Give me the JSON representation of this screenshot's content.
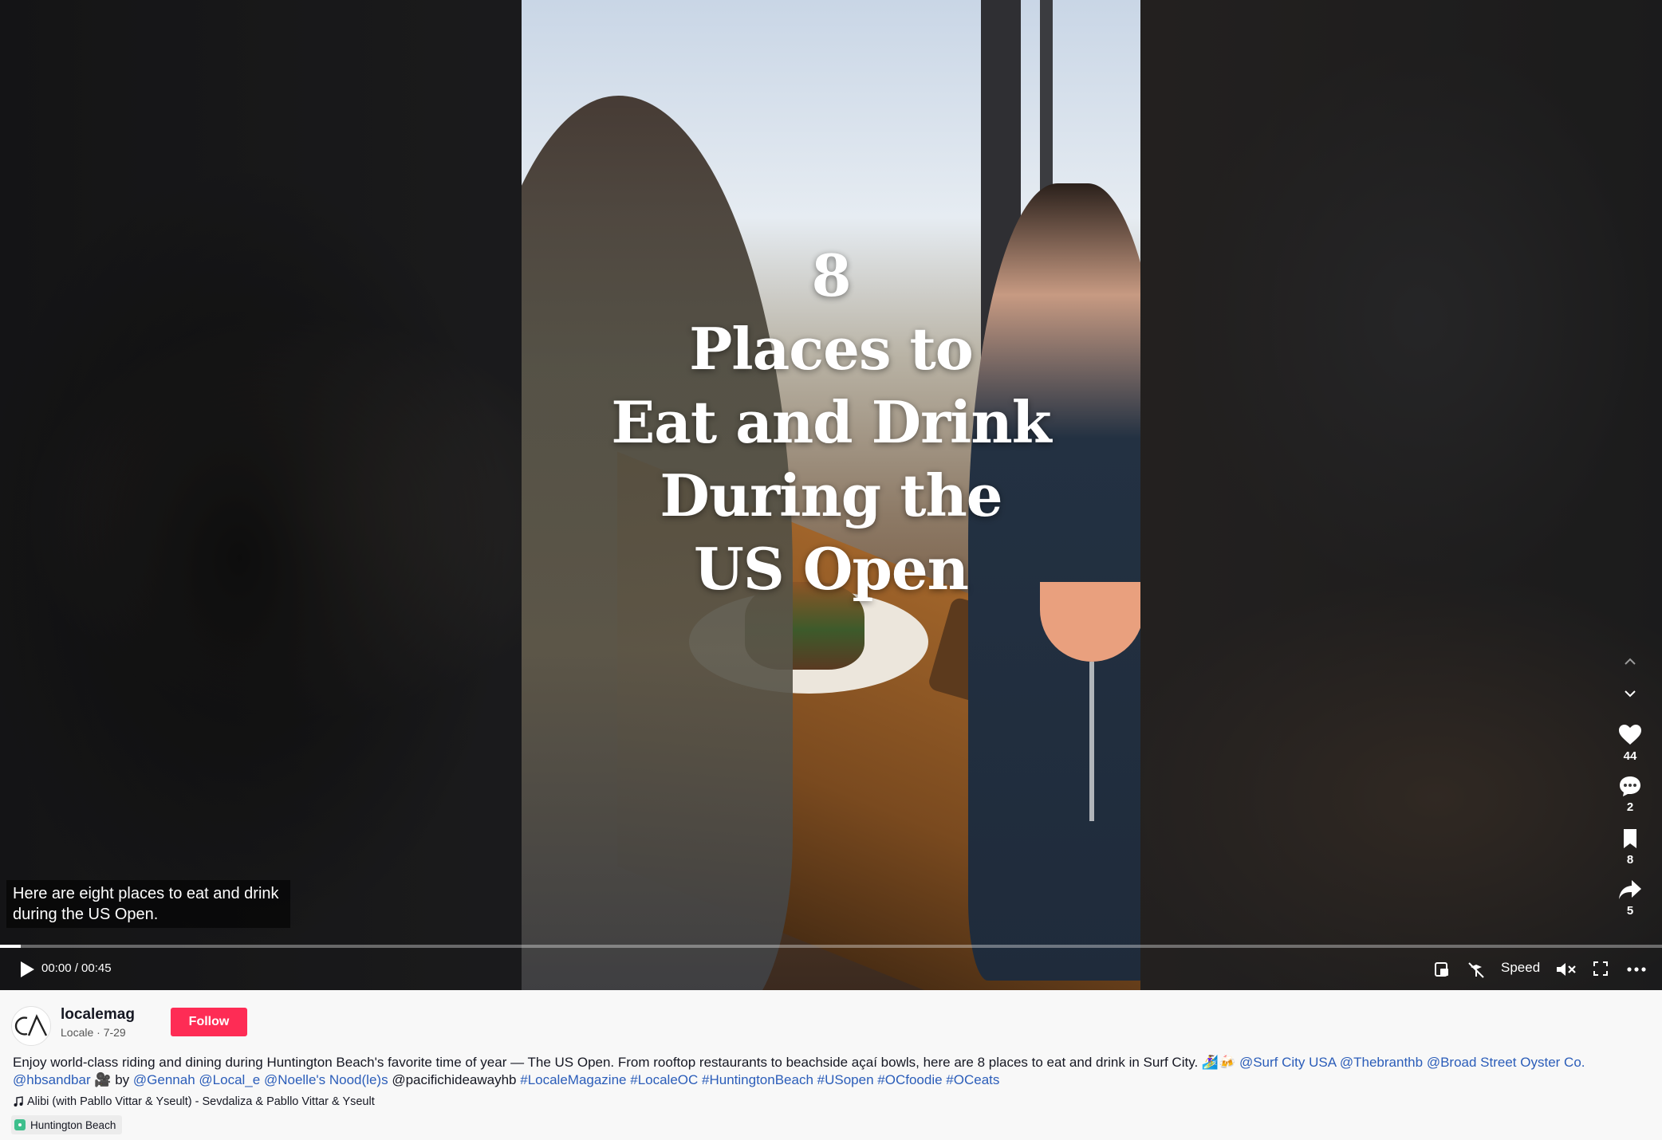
{
  "video": {
    "overlay_title_lines": [
      "8",
      "Places to",
      "Eat and Drink",
      "During the",
      "US Open"
    ],
    "caption": "Here are eight places to eat and drink during the US Open.",
    "progress_fraction": 0.0
  },
  "controls": {
    "time": "00:00 / 00:45",
    "speed_label": "Speed"
  },
  "side_actions": {
    "likes": "44",
    "comments": "2",
    "saves": "8",
    "shares": "5"
  },
  "author": {
    "username": "localemag",
    "meta": "Locale · 7-29",
    "follow_label": "Follow"
  },
  "description": {
    "text_1": "Enjoy world-class riding and dining during Huntington Beach's favorite time of year — The US Open. From rooftop restaurants to beachside açaí bowls, here are 8 places to eat and drink in Surf City. 🏄‍♀️🍻 ",
    "mentions_1": [
      "@Surf City USA",
      "@Thebranthb",
      "@Broad Street Oyster Co.",
      "@hbsandbar"
    ],
    "text_2": " 🎥 by ",
    "mentions_2": [
      "@Gennah",
      "@Local_e",
      "@Noelle's Nood(le)s"
    ],
    "plain_mention": "@pacifichideawayhb",
    "hashtags": [
      "#LocaleMagazine",
      "#LocaleOC",
      "#HuntingtonBeach",
      "#USopen",
      "#OCfoodie",
      "#OCeats"
    ]
  },
  "music": "Alibi (with Pabllo Vittar & Yseult) - Sevdaliza & Pabllo Vittar & Yseult",
  "location": "Huntington Beach",
  "colors": {
    "accent": "#fe2c55",
    "link": "#2b5db9",
    "location_pin": "#3dbf8c"
  },
  "icons": {
    "play": "play-icon",
    "pip": "picture-in-picture-icon",
    "no_ads": "no-distraction-icon",
    "mute": "muted-speaker-icon",
    "fullscreen": "fullscreen-icon",
    "more": "more-icon",
    "like": "heart-icon",
    "comment": "comment-icon",
    "save": "bookmark-icon",
    "share": "share-icon",
    "up": "chevron-up-icon",
    "down": "chevron-down-icon",
    "music": "music-note-icon",
    "location": "location-pin-icon"
  }
}
